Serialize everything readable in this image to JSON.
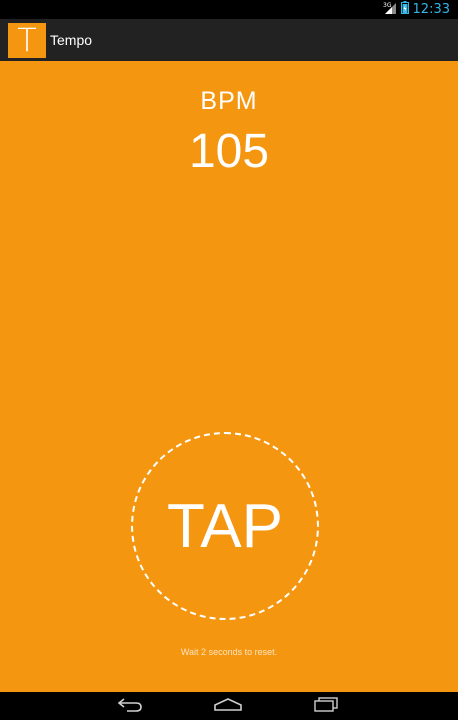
{
  "status_bar": {
    "network": "3G",
    "time": "12:33",
    "accent": "#33b5e5"
  },
  "app": {
    "icon_letter": "T",
    "title": "Tempo",
    "background": "#f4960f"
  },
  "main": {
    "bpm_label": "BPM",
    "bpm_value": "105",
    "tap_label": "TAP",
    "hint": "Wait 2 seconds to reset."
  },
  "nav_bar": {
    "icons": [
      "back-icon",
      "home-icon",
      "recents-icon"
    ]
  }
}
